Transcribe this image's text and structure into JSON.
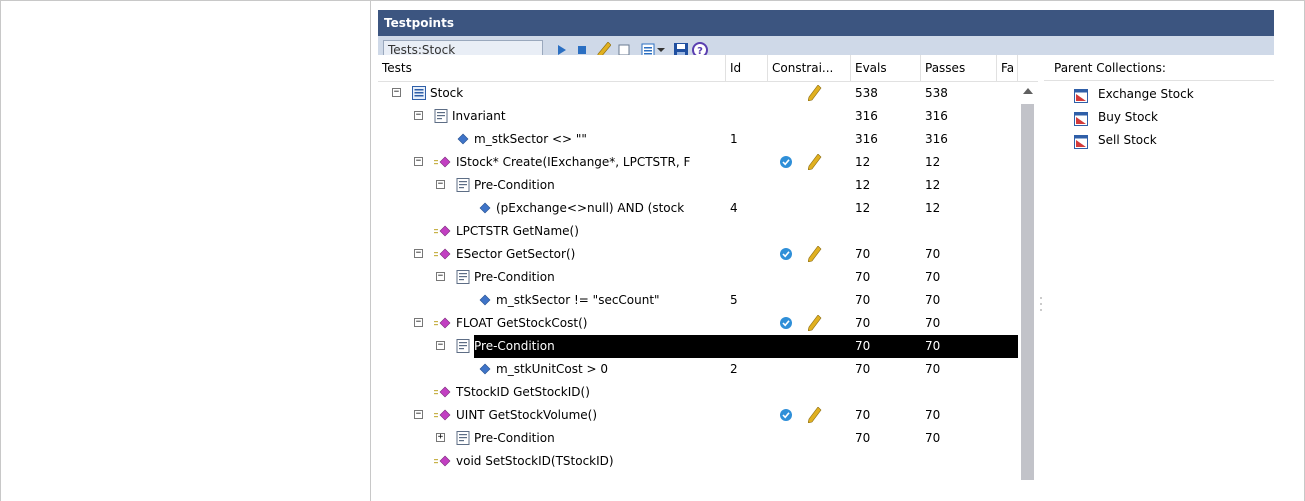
{
  "window": {
    "title": "Testpoints"
  },
  "toolbar": {
    "search_value": "Tests:Stock",
    "icons": [
      "run-icon",
      "stop-icon",
      "edit-pencil-icon",
      "checkbox-icon",
      "options-dropdown-icon",
      "save-icon",
      "help-icon"
    ]
  },
  "columns": [
    "Tests",
    "Id",
    "Constrai...",
    "Evals",
    "Passes",
    "Fa"
  ],
  "rows": [
    {
      "label": "Stock",
      "id": "",
      "constraint": "pencil",
      "evals": "538",
      "passes": "538"
    },
    {
      "label": "Invariant",
      "id": "",
      "constraint": "",
      "evals": "316",
      "passes": "316"
    },
    {
      "label": "m_stkSector <> \"\"",
      "id": "1",
      "constraint": "",
      "evals": "316",
      "passes": "316"
    },
    {
      "label": "IStock* Create(IExchange*, LPCTSTR, F",
      "id": "",
      "constraint": "check,pencil",
      "evals": "12",
      "passes": "12"
    },
    {
      "label": "Pre-Condition",
      "id": "",
      "constraint": "",
      "evals": "12",
      "passes": "12"
    },
    {
      "label": "(pExchange<>null) AND (stock",
      "id": "4",
      "constraint": "",
      "evals": "12",
      "passes": "12"
    },
    {
      "label": "LPCTSTR GetName()",
      "id": "",
      "constraint": "",
      "evals": "",
      "passes": ""
    },
    {
      "label": "ESector GetSector()",
      "id": "",
      "constraint": "check,pencil",
      "evals": "70",
      "passes": "70"
    },
    {
      "label": "Pre-Condition",
      "id": "",
      "constraint": "",
      "evals": "70",
      "passes": "70"
    },
    {
      "label": "m_stkSector != \"secCount\"",
      "id": "5",
      "constraint": "",
      "evals": "70",
      "passes": "70"
    },
    {
      "label": "FLOAT GetStockCost()",
      "id": "",
      "constraint": "check,pencil",
      "evals": "70",
      "passes": "70"
    },
    {
      "label": "Pre-Condition",
      "id": "",
      "constraint": "",
      "evals": "70",
      "passes": "70",
      "selected": true
    },
    {
      "label": "m_stkUnitCost > 0",
      "id": "2",
      "constraint": "",
      "evals": "70",
      "passes": "70"
    },
    {
      "label": "TStockID GetStockID()",
      "id": "",
      "constraint": "",
      "evals": "",
      "passes": ""
    },
    {
      "label": "UINT GetStockVolume()",
      "id": "",
      "constraint": "check,pencil",
      "evals": "70",
      "passes": "70"
    },
    {
      "label": "Pre-Condition",
      "id": "",
      "constraint": "",
      "evals": "70",
      "passes": "70"
    },
    {
      "label": "void SetStockID(TStockID)",
      "id": "",
      "constraint": "",
      "evals": "",
      "passes": ""
    }
  ],
  "parent_collections": {
    "header": "Parent Collections:",
    "items": [
      "Exchange Stock",
      "Buy Stock",
      "Sell Stock"
    ]
  },
  "colors": {
    "titlebar": "#3c5580",
    "toolbar": "#cfd9e8",
    "selection": "#000000",
    "check": "#2f8fd8",
    "pencil": "#e0b020"
  }
}
